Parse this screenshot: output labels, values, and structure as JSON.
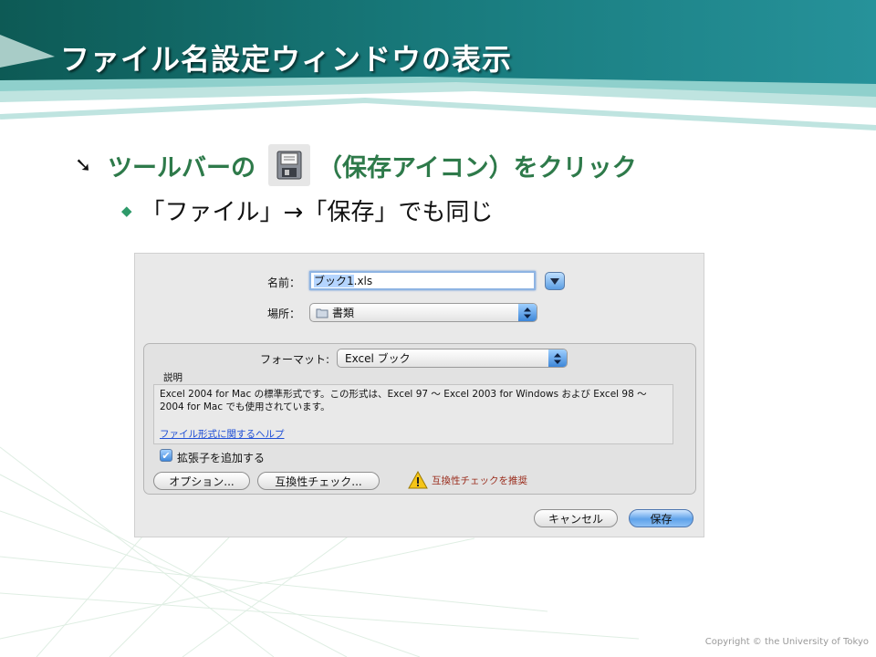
{
  "slide": {
    "title": "ファイル名設定ウィンドウの表示",
    "bullet1_before": "ツールバーの",
    "bullet1_after": "（保存アイコン）をクリック",
    "bullet2": "「ファイル」→「保存」でも同じ",
    "copyright": "Copyright © the University of Tokyo"
  },
  "dialog": {
    "name_label": "名前：",
    "name_value_selected": "ブック1",
    "name_value_ext": ".xls",
    "location_label": "場所：",
    "location_value": "書類",
    "format_label": "フォーマット:",
    "format_value": "Excel ブック",
    "description_label": "説明",
    "description_text": "Excel 2004 for Mac の標準形式です。この形式は、Excel 97 〜 Excel 2003 for Windows および Excel 98 〜 2004 for Mac でも使用されています。",
    "help_link": "ファイル形式に関するヘルプ",
    "extension_checkbox_label": "拡張子を追加する",
    "extension_checked": true,
    "options_button": "オプション...",
    "compat_button": "互換性チェック...",
    "warning_text": "互換性チェックを推奨",
    "cancel_button": "キャンセル",
    "save_button": "保存"
  },
  "colors": {
    "title_text": "#ffffff",
    "header_teal": "#1b7a7c",
    "bullet_green": "#2e7a4a",
    "accent_blue": "#3d86d8",
    "warning_text": "#9a2c1c"
  },
  "icons": [
    "save-icon",
    "bullet-arrow-icon",
    "diamond-bullet-icon",
    "chevron-down-icon",
    "popup-arrows-icon",
    "folder-icon",
    "checkmark-icon",
    "warning-icon"
  ]
}
